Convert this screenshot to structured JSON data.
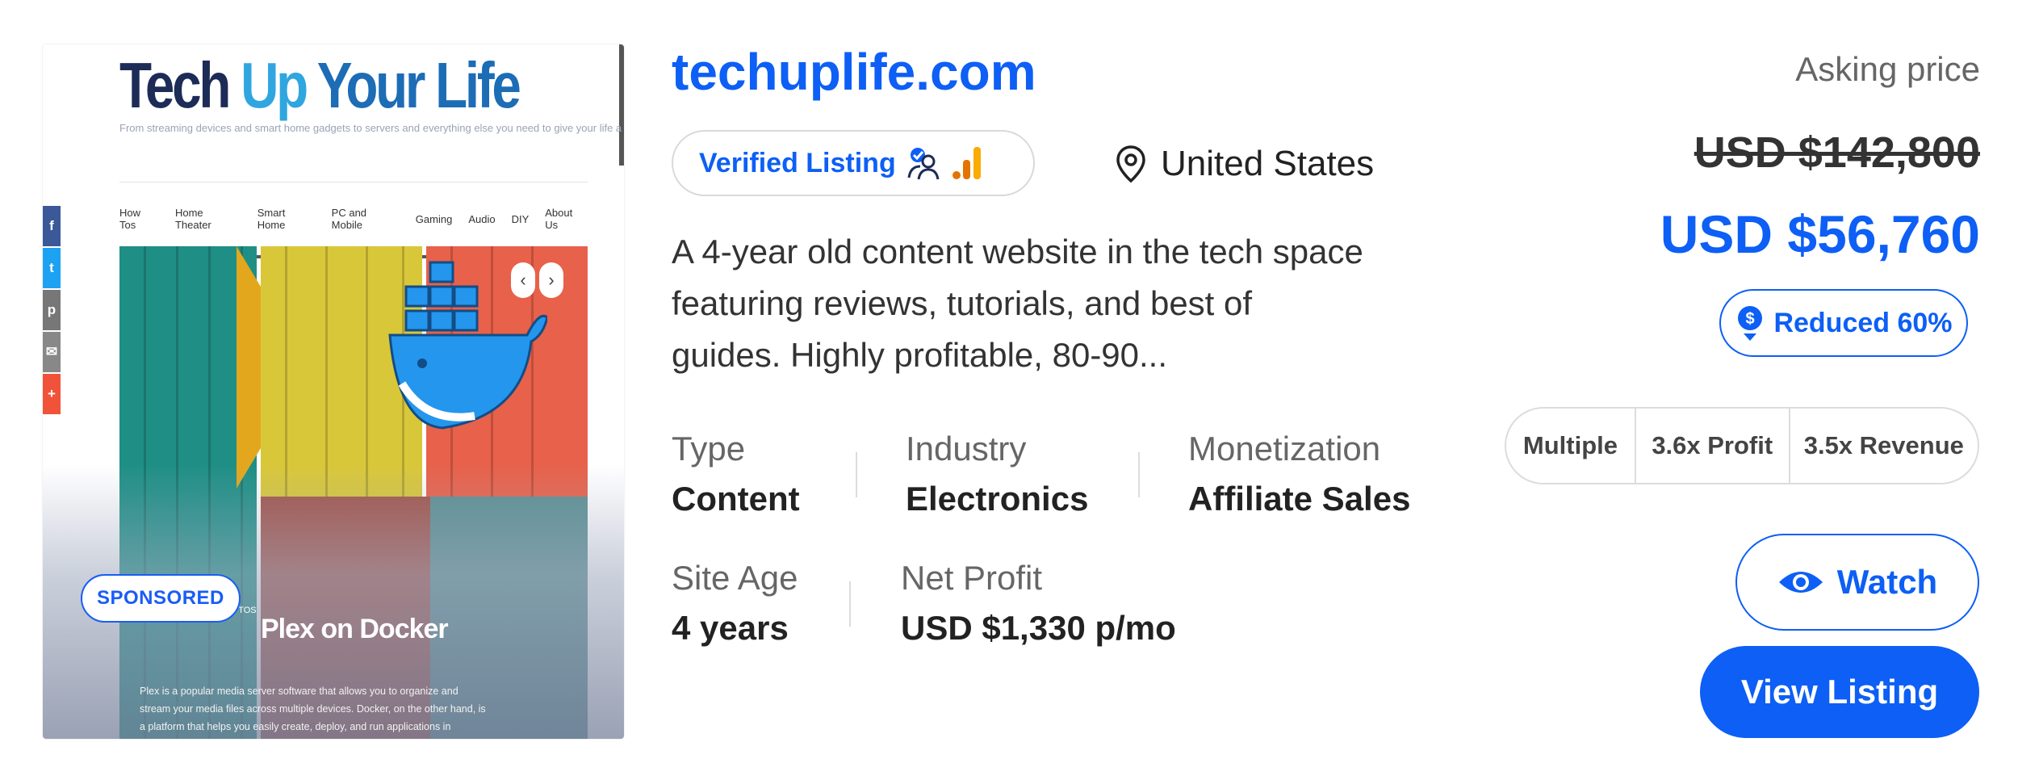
{
  "thumbnail": {
    "site_title_parts": [
      "Tech",
      "Up",
      "Your",
      "Life"
    ],
    "tagline": "From streaming devices and smart home gadgets to servers and everything else you need to give your life a tech up!",
    "menu": [
      "How Tos",
      "Home Theater",
      "Smart Home",
      "PC and Mobile",
      "Gaming",
      "Audio",
      "DIY",
      "About Us"
    ],
    "social_icons": [
      "facebook-icon",
      "twitter-icon",
      "pinterest-icon",
      "email-icon",
      "share-icon"
    ],
    "post_kicker": "HOME THEATER, HOW TOS",
    "post_title": "Plex on Docker",
    "post_excerpt": "Plex is a popular media server software that allows you to organize and stream your media files across multiple devices. Docker, on the other hand, is a platform that helps you easily create, deploy, and run applications in containers. By installing Plex on Docker, you can ensure a consistent and [...]",
    "sponsored_label": "SPONSORED"
  },
  "listing": {
    "domain": "techuplife.com",
    "verified_label": "Verified Listing",
    "location": "United States",
    "description": "A 4-year old content website in the tech space featuring reviews, tutorials, and best of guides. Highly profitable, 80-90...",
    "stats": {
      "type": {
        "label": "Type",
        "value": "Content"
      },
      "industry": {
        "label": "Industry",
        "value": "Electronics"
      },
      "monetization": {
        "label": "Monetization",
        "value": "Affiliate Sales"
      },
      "site_age": {
        "label": "Site Age",
        "value": "4 years"
      },
      "net_profit": {
        "label": "Net Profit",
        "value": "USD $1,330 p/mo"
      }
    }
  },
  "pricing": {
    "asking_label": "Asking price",
    "old_price": "USD $142,800",
    "new_price": "USD $56,760",
    "reduced_label": "Reduced 60%",
    "multiples": {
      "label": "Multiple",
      "profit": "3.6x Profit",
      "revenue": "3.5x Revenue"
    }
  },
  "actions": {
    "watch_label": "Watch",
    "view_label": "View Listing"
  },
  "colors": {
    "accent": "#0d5ff5",
    "analytics_orange": "#f29d0a"
  }
}
